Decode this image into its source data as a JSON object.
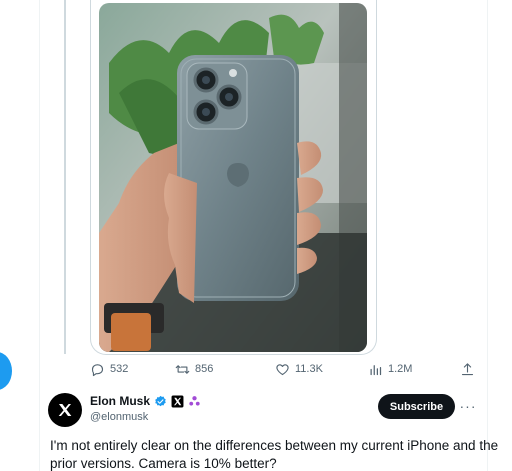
{
  "tweet_above": {
    "stats": {
      "replies": "532",
      "reposts": "856",
      "likes": "11.3K",
      "views": "1.2M"
    }
  },
  "author": {
    "display_name": "Elon Musk",
    "handle": "@elonmusk",
    "avatar_icon": "x-logo-icon",
    "badges": [
      "verified-badge-icon",
      "x-affiliate-badge-icon",
      "people-icon"
    ]
  },
  "subscribe_label": "Subscribe",
  "more_label": "···",
  "tweet": {
    "text": "I'm not entirely clear on the differences between my current iPhone and the prior versions. Camera is 10% better?"
  },
  "colors": {
    "accent": "#1d9bf0",
    "text_primary": "#0f1419",
    "text_secondary": "#536471",
    "border": "#cfd9de"
  }
}
